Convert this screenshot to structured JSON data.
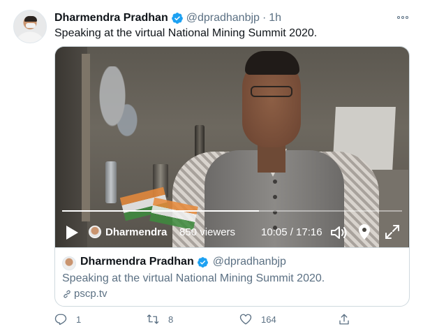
{
  "tweet": {
    "author_name": "Dharmendra Pradhan",
    "author_handle": "@dpradhanbjp",
    "separator": "·",
    "time": "1h",
    "text": "Speaking at the virtual National Mining Summit 2020.",
    "verified": true
  },
  "video": {
    "broadcaster_name": "Dharmendra ...",
    "viewers": "850 viewers",
    "timecode": "10:05 / 17:16",
    "progress_fraction": 0.58,
    "icons": [
      "play-icon",
      "volume-icon",
      "location-icon",
      "fullscreen-icon"
    ]
  },
  "quote": {
    "author_name": "Dharmendra Pradhan",
    "author_handle": "@dpradhanbjp",
    "text": "Speaking at the virtual National Mining Summit 2020.",
    "link": "pscp.tv"
  },
  "actions": {
    "reply_count": "1",
    "retweet_count": "8",
    "like_count": "164"
  },
  "colors": {
    "verified_blue": "#1da1f2",
    "secondary_text": "#5b7083",
    "border": "#cfd9de"
  }
}
